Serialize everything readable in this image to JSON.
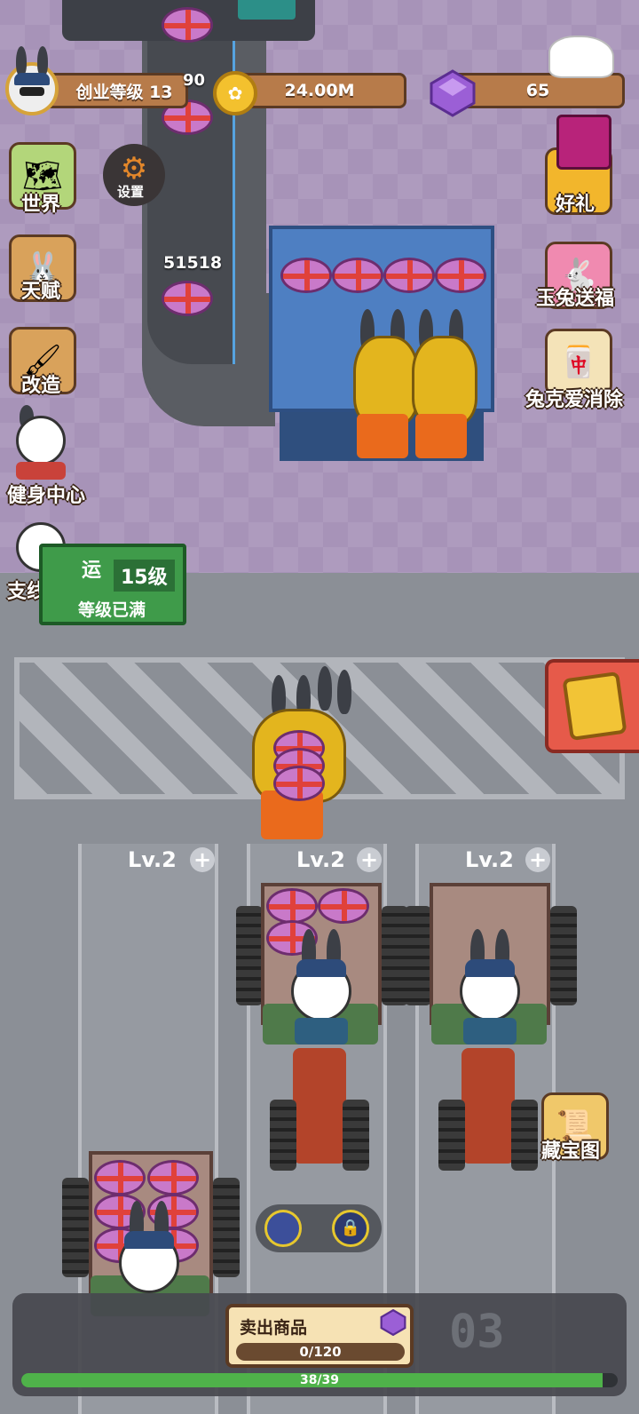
{
  "hud": {
    "level_label": "创业等级 13",
    "coins": "24.00M",
    "gems": "65",
    "conveyor_partial": "90",
    "conveyor_count": "51518"
  },
  "left_menu": {
    "world": "世界",
    "settings": "设置",
    "talent": "天赋",
    "remodel": "改造",
    "gym": "健身中心",
    "side_workshop": "支线车间"
  },
  "right_menu": {
    "gift": "好礼",
    "jade_rabbit": "玉兔送福",
    "match_game": "兔克爱消除",
    "treasure_map": "藏宝图"
  },
  "machine_sign": {
    "partial_text": "运",
    "level": "15级",
    "status": "等级已满"
  },
  "lanes": [
    {
      "level": "Lv.2"
    },
    {
      "level": "Lv.2"
    },
    {
      "level": "Lv.2"
    }
  ],
  "bottom": {
    "sell_label": "卖出商品",
    "sell_progress": "0/120",
    "sell_progress_fraction": 0,
    "lane_number": "03",
    "xp_progress": "38/39",
    "xp_progress_fraction": 0.974
  },
  "colors": {
    "purple_floor": "#a793b8",
    "gray_floor": "#8b8f96",
    "panel_brown": "#b77b4a",
    "xp_green": "#4fb24a",
    "gem_purple": "#9b5fd6"
  }
}
